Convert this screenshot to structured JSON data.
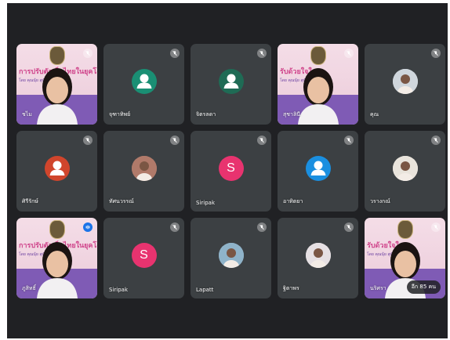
{
  "participants": [
    {
      "name": "ชไม",
      "kind": "video",
      "mic": "muted"
    },
    {
      "name": "จุฑาทิพย์",
      "kind": "avatar",
      "avatar_color": "#1a8f74",
      "mic": "muted"
    },
    {
      "name": "จิตรลดา",
      "kind": "avatar",
      "avatar_color": "#1f6b55",
      "mic": "muted"
    },
    {
      "name": "สุชาลินี",
      "kind": "video",
      "mic": "muted"
    },
    {
      "name": "คุณ",
      "kind": "photo",
      "avatar_color": "#cfd6dc",
      "mic": "muted"
    },
    {
      "name": "ศิรีรักษ์",
      "kind": "avatar",
      "avatar_color": "#d0452c",
      "mic": "muted"
    },
    {
      "name": "ทัศนวรรณ์",
      "kind": "photo",
      "avatar_color": "#b07a6a",
      "mic": "muted"
    },
    {
      "name": "Siripak",
      "kind": "letter",
      "letter": "S",
      "avatar_color": "#e8336f",
      "mic": "muted"
    },
    {
      "name": "อาทิตยา",
      "kind": "avatar",
      "avatar_color": "#1a8fe0",
      "mic": "muted"
    },
    {
      "name": "วรางกณ์",
      "kind": "photo",
      "avatar_color": "#e9e4dc",
      "mic": "muted"
    },
    {
      "name": "ภูสิทธิ์",
      "kind": "video",
      "mic": "active"
    },
    {
      "name": "Siripak",
      "kind": "letter",
      "letter": "S",
      "avatar_color": "#e8336f",
      "mic": "muted"
    },
    {
      "name": "Lapatt",
      "kind": "photo",
      "avatar_color": "#8fb3c9",
      "mic": "muted"
    },
    {
      "name": "ฐิตาพร",
      "kind": "photo",
      "avatar_color": "#e6e0e3",
      "mic": "muted"
    },
    {
      "name": "นริศรา",
      "kind": "video",
      "mic": "muted",
      "more_label": "อีก 85 คน"
    }
  ],
  "banner": {
    "title": "รับด้วยใจในยุค",
    "title_alt": "การปรับตัวเด็กไทยในยุคโควิ",
    "sub": "โดย คุณนุ้ย สุมัยประเ"
  },
  "icons": {
    "mic_off": "mic-off-icon",
    "mic_on": "mic-on-icon"
  }
}
